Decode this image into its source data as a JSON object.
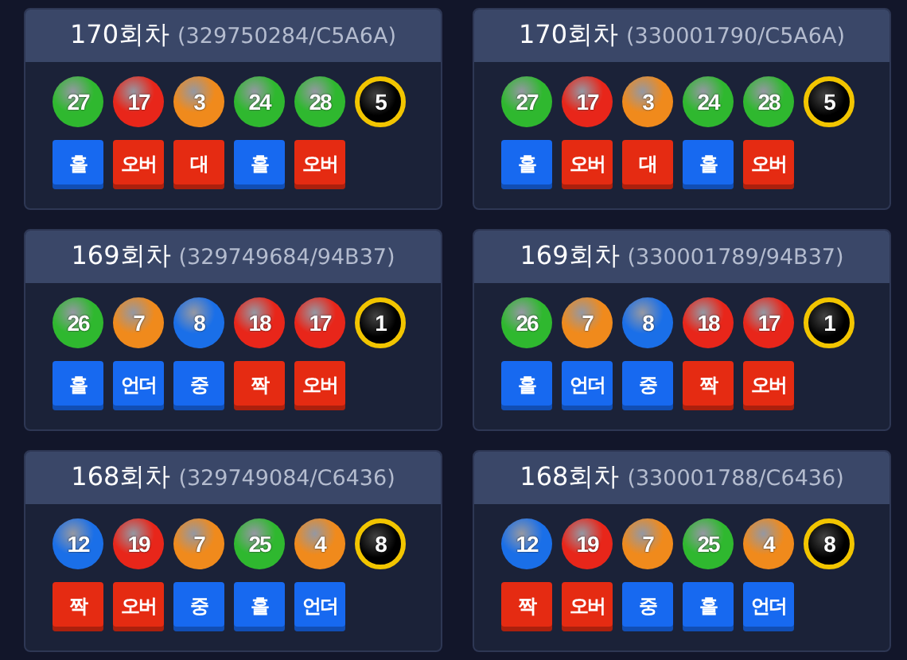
{
  "rounds": [
    {
      "title": "170회차",
      "code": "(329750284/C5A6A)",
      "balls": [
        {
          "kind": "ball",
          "number": "27",
          "color": "#2fb82f"
        },
        {
          "kind": "ball",
          "number": "17",
          "color": "#e8261a"
        },
        {
          "kind": "ball",
          "number": "3",
          "color": "#f08a1c"
        },
        {
          "kind": "ball",
          "number": "24",
          "color": "#2fb82f"
        },
        {
          "kind": "ball",
          "number": "28",
          "color": "#2fb82f"
        },
        {
          "kind": "bonus",
          "number": "5",
          "color": "#000000"
        }
      ],
      "tags": [
        {
          "label": "홀",
          "color": "#1769f0"
        },
        {
          "label": "오버",
          "color": "#e52b12"
        },
        {
          "label": "대",
          "color": "#e52b12"
        },
        {
          "label": "홀",
          "color": "#1769f0"
        },
        {
          "label": "오버",
          "color": "#e52b12"
        }
      ]
    },
    {
      "title": "170회차",
      "code": "(330001790/C5A6A)",
      "balls": [
        {
          "kind": "ball",
          "number": "27",
          "color": "#2fb82f"
        },
        {
          "kind": "ball",
          "number": "17",
          "color": "#e8261a"
        },
        {
          "kind": "ball",
          "number": "3",
          "color": "#f08a1c"
        },
        {
          "kind": "ball",
          "number": "24",
          "color": "#2fb82f"
        },
        {
          "kind": "ball",
          "number": "28",
          "color": "#2fb82f"
        },
        {
          "kind": "bonus",
          "number": "5",
          "color": "#000000"
        }
      ],
      "tags": [
        {
          "label": "홀",
          "color": "#1769f0"
        },
        {
          "label": "오버",
          "color": "#e52b12"
        },
        {
          "label": "대",
          "color": "#e52b12"
        },
        {
          "label": "홀",
          "color": "#1769f0"
        },
        {
          "label": "오버",
          "color": "#e52b12"
        }
      ]
    },
    {
      "title": "169회차",
      "code": "(329749684/94B37)",
      "balls": [
        {
          "kind": "ball",
          "number": "26",
          "color": "#2fb82f"
        },
        {
          "kind": "ball",
          "number": "7",
          "color": "#f08a1c"
        },
        {
          "kind": "ball",
          "number": "8",
          "color": "#1a6fe8"
        },
        {
          "kind": "ball",
          "number": "18",
          "color": "#e8261a"
        },
        {
          "kind": "ball",
          "number": "17",
          "color": "#e8261a"
        },
        {
          "kind": "bonus",
          "number": "1",
          "color": "#000000"
        }
      ],
      "tags": [
        {
          "label": "홀",
          "color": "#1769f0"
        },
        {
          "label": "언더",
          "color": "#1769f0"
        },
        {
          "label": "중",
          "color": "#1769f0"
        },
        {
          "label": "짝",
          "color": "#e52b12"
        },
        {
          "label": "오버",
          "color": "#e52b12"
        }
      ]
    },
    {
      "title": "169회차",
      "code": "(330001789/94B37)",
      "balls": [
        {
          "kind": "ball",
          "number": "26",
          "color": "#2fb82f"
        },
        {
          "kind": "ball",
          "number": "7",
          "color": "#f08a1c"
        },
        {
          "kind": "ball",
          "number": "8",
          "color": "#1a6fe8"
        },
        {
          "kind": "ball",
          "number": "18",
          "color": "#e8261a"
        },
        {
          "kind": "ball",
          "number": "17",
          "color": "#e8261a"
        },
        {
          "kind": "bonus",
          "number": "1",
          "color": "#000000"
        }
      ],
      "tags": [
        {
          "label": "홀",
          "color": "#1769f0"
        },
        {
          "label": "언더",
          "color": "#1769f0"
        },
        {
          "label": "중",
          "color": "#1769f0"
        },
        {
          "label": "짝",
          "color": "#e52b12"
        },
        {
          "label": "오버",
          "color": "#e52b12"
        }
      ]
    },
    {
      "title": "168회차",
      "code": "(329749084/C6436)",
      "balls": [
        {
          "kind": "ball",
          "number": "12",
          "color": "#1a6fe8"
        },
        {
          "kind": "ball",
          "number": "19",
          "color": "#e8261a"
        },
        {
          "kind": "ball",
          "number": "7",
          "color": "#f08a1c"
        },
        {
          "kind": "ball",
          "number": "25",
          "color": "#2fb82f"
        },
        {
          "kind": "ball",
          "number": "4",
          "color": "#f08a1c"
        },
        {
          "kind": "bonus",
          "number": "8",
          "color": "#000000"
        }
      ],
      "tags": [
        {
          "label": "짝",
          "color": "#e52b12"
        },
        {
          "label": "오버",
          "color": "#e52b12"
        },
        {
          "label": "중",
          "color": "#1769f0"
        },
        {
          "label": "홀",
          "color": "#1769f0"
        },
        {
          "label": "언더",
          "color": "#1769f0"
        }
      ]
    },
    {
      "title": "168회차",
      "code": "(330001788/C6436)",
      "balls": [
        {
          "kind": "ball",
          "number": "12",
          "color": "#1a6fe8"
        },
        {
          "kind": "ball",
          "number": "19",
          "color": "#e8261a"
        },
        {
          "kind": "ball",
          "number": "7",
          "color": "#f08a1c"
        },
        {
          "kind": "ball",
          "number": "25",
          "color": "#2fb82f"
        },
        {
          "kind": "ball",
          "number": "4",
          "color": "#f08a1c"
        },
        {
          "kind": "bonus",
          "number": "8",
          "color": "#000000"
        }
      ],
      "tags": [
        {
          "label": "짝",
          "color": "#e52b12"
        },
        {
          "label": "오버",
          "color": "#e52b12"
        },
        {
          "label": "중",
          "color": "#1769f0"
        },
        {
          "label": "홀",
          "color": "#1769f0"
        },
        {
          "label": "언더",
          "color": "#1769f0"
        }
      ]
    }
  ]
}
